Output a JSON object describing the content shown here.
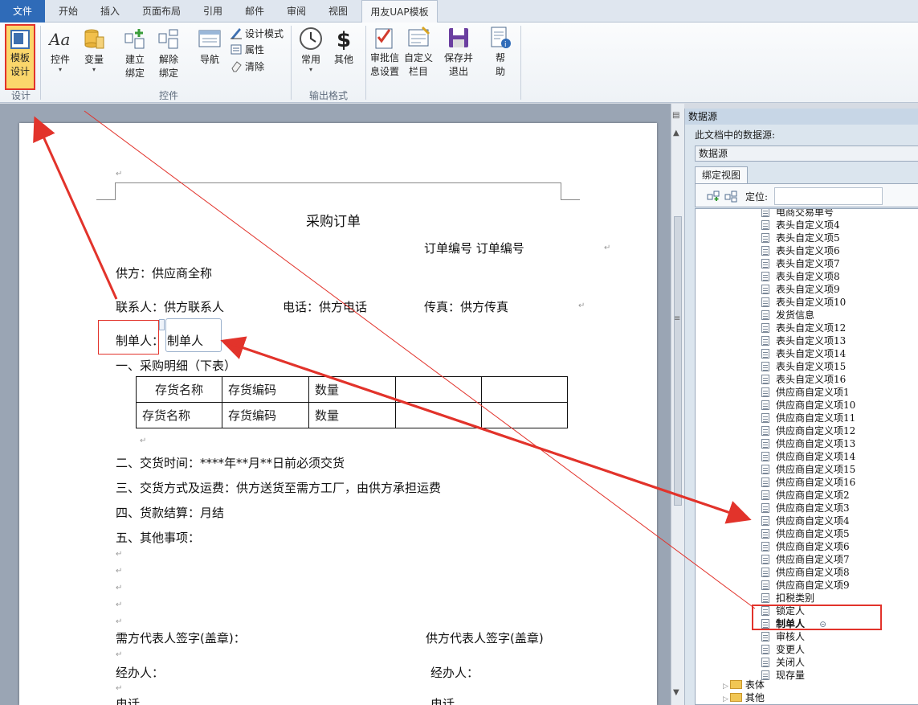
{
  "ribbon": {
    "tabs": [
      "文件",
      "开始",
      "插入",
      "页面布局",
      "引用",
      "邮件",
      "审阅",
      "视图",
      "用友UAP模板"
    ],
    "buttons": {
      "template_design": "模板\n设计",
      "control": "控件",
      "variable": "变量",
      "create_bind": "建立\n绑定",
      "remove_bind": "解除\n绑定",
      "navigate": "导航",
      "design_mode": "设计模式",
      "properties": "属性",
      "clear": "清除",
      "common": "常用",
      "other": "其他",
      "approval": "审批信\n息设置",
      "custom_bar": "自定义\n栏目",
      "save_exit": "保存并\n退出",
      "help": "帮\n助"
    },
    "groups": {
      "design": "设计",
      "controls": "控件",
      "output_format": "输出格式"
    }
  },
  "document": {
    "title": "采购订单",
    "order_no": "订单编号  订单编号",
    "supplier": "供方：供应商全称",
    "contact": "联系人：供方联系人",
    "phone": "电话：供方电话",
    "fax": "传真：供方传真",
    "maker_label": "制单人：",
    "maker_value": "制单人",
    "section1": "一、采购明细（下表）",
    "table": {
      "rows": [
        [
          "存货名称",
          "存货编码",
          "数量",
          "",
          ""
        ],
        [
          "存货名称",
          "存货编码",
          "数量",
          "",
          ""
        ]
      ]
    },
    "section2": "二、交货时间：****年**月**日前必须交货",
    "section3": "三、交货方式及运费：供方送货至需方工厂，由供方承担运费",
    "section4": "四、货款结算：月结",
    "section5": "五、其他事项：",
    "buyer_sign": "需方代表人签字(盖章)：",
    "seller_sign": "供方代表人签字(盖章)",
    "handler_left": "经办人：",
    "handler_right": "经办人：",
    "phone_left": "电话",
    "phone_right": "电话"
  },
  "panel": {
    "title": "数据源",
    "doc_sources": "此文档中的数据源:",
    "source_select": "数据源",
    "tab_bind_view": "绑定视图",
    "locate_label": "定位:",
    "items": [
      "电商交易单号",
      "表头自定义项4",
      "表头自定义项5",
      "表头自定义项6",
      "表头自定义项7",
      "表头自定义项8",
      "表头自定义项9",
      "表头自定义项10",
      "发货信息",
      "表头自定义项12",
      "表头自定义项13",
      "表头自定义项14",
      "表头自定义项15",
      "表头自定义项16",
      "供应商自定义项1",
      "供应商自定义项10",
      "供应商自定义项11",
      "供应商自定义项12",
      "供应商自定义项13",
      "供应商自定义项14",
      "供应商自定义项15",
      "供应商自定义项16",
      "供应商自定义项2",
      "供应商自定义项3",
      "供应商自定义项4",
      "供应商自定义项5",
      "供应商自定义项6",
      "供应商自定义项7",
      "供应商自定义项8",
      "供应商自定义项9",
      "扣税类别",
      "锁定人",
      "制单人",
      "审核人",
      "变更人",
      "关闭人",
      "现存量"
    ],
    "folders": [
      "表体",
      "其他"
    ]
  },
  "colors": {
    "highlight_red": "#e2332b",
    "ribbon_accent": "#2f6bb8"
  }
}
